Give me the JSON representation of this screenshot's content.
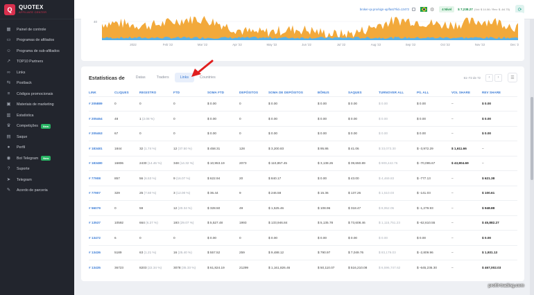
{
  "brand": {
    "name": "QUOTEX",
    "sub": "AFFILIATE CENTER"
  },
  "sidebar": {
    "items": [
      {
        "label": "Painel de controle",
        "icon": "dashboard-icon",
        "badge": ""
      },
      {
        "label": "Programas de afiliados",
        "icon": "folder-icon",
        "badge": ""
      },
      {
        "label": "Programa de sub-afiliados",
        "icon": "users-icon",
        "badge": ""
      },
      {
        "label": "TOP10 Partners",
        "icon": "trend-icon",
        "badge": ""
      },
      {
        "label": "Links",
        "icon": "link-icon",
        "badge": ""
      },
      {
        "label": "Postback",
        "icon": "postback-icon",
        "badge": ""
      },
      {
        "label": "Códigos promocionais",
        "icon": "code-icon",
        "badge": ""
      },
      {
        "label": "Materiais de marketing",
        "icon": "image-icon",
        "badge": ""
      },
      {
        "label": "Estatística",
        "icon": "stats-icon",
        "badge": ""
      },
      {
        "label": "Competições",
        "icon": "trophy-icon",
        "badge": "New"
      },
      {
        "label": "Saque",
        "icon": "wallet-icon",
        "badge": ""
      },
      {
        "label": "Perfil",
        "icon": "profile-icon",
        "badge": ""
      },
      {
        "label": "Bot Telegram",
        "icon": "bot-icon",
        "badge": "New"
      },
      {
        "label": "Suporte",
        "icon": "support-icon",
        "badge": ""
      },
      {
        "label": "Telegram",
        "icon": "telegram-icon",
        "badge": ""
      },
      {
        "label": "Acordo de parceria",
        "icon": "contract-icon",
        "badge": ""
      }
    ]
  },
  "topbar": {
    "ref_link": "broker-qx.pro/sign-up/fast/?lid=13472",
    "level": "4 Nível",
    "balance": "$ 7,238.27",
    "balance_sub": "(Vol: $ 14.06 / Rev: $ -64.75)"
  },
  "chart": {
    "x_ticks": [
      "2022",
      "Feb '22",
      "Mar '22",
      "Apr '22",
      "May '22",
      "Jun '22",
      "Jul '22",
      "Aug '22",
      "Sep '22",
      "Oct '22",
      "Nov '22",
      "Dec '2"
    ],
    "y_tick": "40"
  },
  "stats": {
    "title": "Estatísticas de",
    "tabs": [
      "Datas",
      "Traders",
      "Links",
      "Countries"
    ],
    "active_tab": "Links",
    "pager": "61–72 de 72",
    "columns": [
      "LINK",
      "CLIQUES",
      "REGISTRO",
      "FTD",
      "SOMA FTD",
      "DEPÓSITOS",
      "SOMA DE DEPÓSITOS",
      "BÔNUS",
      "SAQUES",
      "TURNOVER ALL",
      "P/L ALL",
      "VOL SHARE",
      "REV SHARE"
    ],
    "rows": [
      [
        "# 205889",
        "0",
        "0",
        "",
        "0",
        "",
        "$ 0.00",
        "0",
        "$ 0.00",
        "$ 0.00",
        "$ 0.00",
        "$ 0.00",
        "$ 0.00",
        "–",
        "$ 0.00"
      ],
      [
        "# 205464",
        "48",
        "1",
        "(2.08 %)",
        "0",
        "",
        "$ 0.00",
        "0",
        "$ 0.00",
        "$ 0.00",
        "$ 0.00",
        "$ 0.00",
        "$ 0.00",
        "–",
        "$ 0.00"
      ],
      [
        "# 205463",
        "67",
        "0",
        "",
        "0",
        "",
        "$ 0.00",
        "0",
        "$ 0.00",
        "$ 0.00",
        "$ 0.00",
        "$ 0.00",
        "$ 0.00",
        "–",
        "$ 0.00"
      ],
      [
        "# 183481",
        "1844",
        "32",
        "(1.74 %)",
        "12",
        "(37.50 %)",
        "$ 458.31",
        "128",
        "$ 3,200.83",
        "$ 95.86",
        "$ 41.06",
        "$ 33,073.30",
        "$ -3,972.29",
        "$ 1,611.66",
        "–"
      ],
      [
        "# 183480",
        "16806",
        "2430",
        "(14.46 %)",
        "348",
        "(14.32 %)",
        "$ 10,953.19",
        "2073",
        "$ 110,857.45",
        "$ 3,138.26",
        "$ 39,650.89",
        "$ 909,442.76",
        "$ -70,095.67",
        "$ 43,804.69",
        "–"
      ],
      [
        "# 77908",
        "857",
        "56",
        "(6.53 %)",
        "9",
        "(16.07 %)",
        "$ 622.94",
        "20",
        "$ 840.17",
        "$ 0.00",
        "$ 43.00",
        "$ 4,469.83",
        "$ -777.13",
        "–",
        "$ 621.38"
      ],
      [
        "# 77907",
        "329",
        "25",
        "(7.60 %)",
        "3",
        "(12.00 %)",
        "$ 36.44",
        "9",
        "$ 246.58",
        "$ 15.36",
        "$ 137.26",
        "$ 1,510.03",
        "$ -141.03",
        "–",
        "$ 100.61"
      ],
      [
        "# 56079",
        "0",
        "59",
        "",
        "12",
        "(20.34 %)",
        "$ 328.50",
        "49",
        "$ 1,525.46",
        "$ 108.96",
        "$ 318.47",
        "$ 8,952.05",
        "$ -1,279.93",
        "–",
        "$ 948.88"
      ],
      [
        "# 13537",
        "10592",
        "664",
        "(6.27 %)",
        "193",
        "(29.07 %)",
        "$ 5,527.48",
        "1993",
        "$ 133,946.84",
        "$ 5,135.78",
        "$ 73,608.46",
        "$ 1,115,751.23",
        "$ -62,610.55",
        "–",
        "$ 45,882.27"
      ],
      [
        "# 13472",
        "6",
        "0",
        "",
        "0",
        "",
        "$ 0.00",
        "0",
        "$ 0.00",
        "$ 0.00",
        "$ 0.00",
        "$ 0.00",
        "$ 0.00",
        "–",
        "$ 0.00"
      ],
      [
        "# 13436",
        "5189",
        "63",
        "(1.21 %)",
        "16",
        "(25.40 %)",
        "$ 557.52",
        "259",
        "$ 9,488.12",
        "$ 790.97",
        "$ 7,049.76",
        "$ 83,179.03",
        "$ -2,809.96",
        "–",
        "$ 1,931.13"
      ],
      [
        "# 13435",
        "36723",
        "8203",
        "(22.34 %)",
        "3078",
        "(35.33 %)",
        "$ 61,824.19",
        "21299",
        "$ 1,161,826.46",
        "$ 50,110.07",
        "$ 516,210.08",
        "$ 6,596,747.62",
        "$ -645,236.30",
        "–",
        "$ 467,002.03"
      ]
    ]
  },
  "watermark": "profit-trading.com",
  "colors": {
    "accent": "#3a7bd5",
    "brand": "#d9304e",
    "chart": "#f2a93b",
    "chart2": "#5ab1e6"
  }
}
